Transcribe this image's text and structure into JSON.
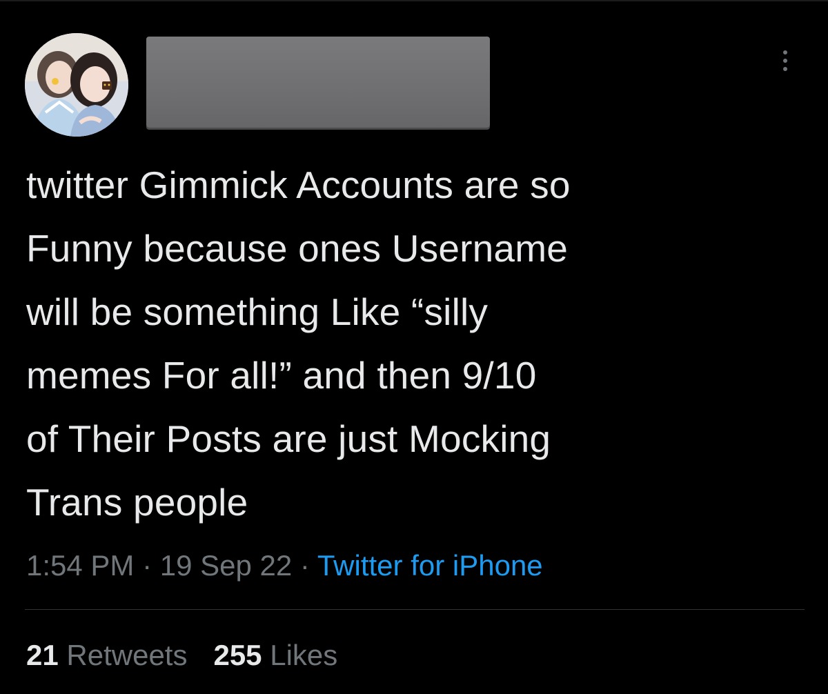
{
  "tweet": {
    "text": "twitter Gimmick Accounts are so\nFunny because ones Username\nwill be something Like “silly\nmemes For all!” and then 9/10\nof Their Posts are just Mocking\nTrans people",
    "time": "1:54 PM",
    "date": "19 Sep 22",
    "separator": " · ",
    "source": "Twitter for iPhone"
  },
  "stats": {
    "retweets_count": "21",
    "retweets_label": "Retweets",
    "likes_count": "255",
    "likes_label": "Likes"
  },
  "icons": {
    "more": "more-horizontal-icon"
  },
  "colors": {
    "background": "#000000",
    "text_primary": "#e7e9ea",
    "text_secondary": "#71767b",
    "link": "#1d9bf0",
    "redaction": "#707072"
  }
}
